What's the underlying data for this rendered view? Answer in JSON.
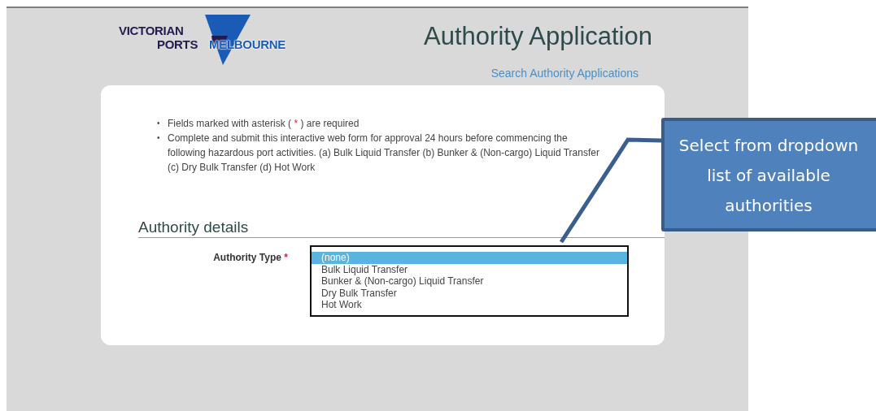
{
  "logo": {
    "line_1": "VICTORIAN",
    "line_2": "PORTS",
    "line_3": "MELBOURNE"
  },
  "title": "Authority Application",
  "search_link": "Search Authority Applications",
  "instructions": [
    {
      "bullet": "•",
      "text_before": "Fields marked with asterisk ( ",
      "mark": "*",
      "text_after": " ) are required"
    },
    {
      "bullet": "•",
      "text": "Complete and submit this interactive web form for approval 24 hours before commencing the following hazardous port activities. (a) Bulk Liquid Transfer (b) Bunker & (Non-cargo) Liquid Transfer (c) Dry Bulk Transfer (d) Hot Work"
    }
  ],
  "section_heading": "Authority details",
  "authority_type": {
    "label": "Authority Type",
    "required_mark": "*",
    "options": [
      {
        "label": "(none)",
        "selected": true
      },
      {
        "label": "Bulk Liquid Transfer",
        "selected": false
      },
      {
        "label": "Bunker & (Non-cargo) Liquid Transfer",
        "selected": false
      },
      {
        "label": "Dry Bulk Transfer",
        "selected": false
      },
      {
        "label": "Hot Work",
        "selected": false
      }
    ]
  },
  "callout": {
    "text": "Select from dropdown list of available authorities"
  }
}
